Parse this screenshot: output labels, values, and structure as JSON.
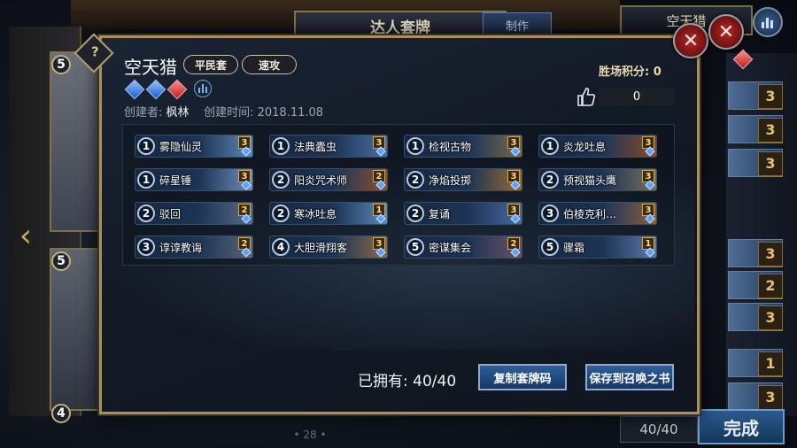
{
  "background": {
    "header_title": "达人套牌",
    "make_tab_label": "制作",
    "deck_name_tab": "空天猎",
    "left_costs": [
      "5",
      "5",
      "4"
    ],
    "right_counts": [
      "3",
      "3",
      "3",
      "3",
      "2",
      "3",
      "1",
      "3"
    ],
    "deck_count": "40/40",
    "done_label": "完成",
    "page_number": "• 28 •"
  },
  "dialog": {
    "deck_name": "空天猎",
    "tags": [
      "平民套",
      "速攻"
    ],
    "gems": [
      "blue",
      "blue",
      "red"
    ],
    "creator_label": "创建者:",
    "creator": "枫林",
    "created_label": "创建时间:",
    "created": "2018.11.08",
    "win_points_label": "胜场积分: 0",
    "likes": "0",
    "owned_label": "已拥有:",
    "owned_value": "40/40",
    "copy_button": "复制套牌码",
    "save_button": "保存到召唤之书",
    "cards": [
      {
        "cost": "1",
        "name": "雾隐仙灵",
        "qty": "3",
        "art": "#5c88b8"
      },
      {
        "cost": "1",
        "name": "法典蠹虫",
        "qty": "3",
        "art": "#4a6fa5"
      },
      {
        "cost": "1",
        "name": "检视古物",
        "qty": "3",
        "art": "#7a6a48"
      },
      {
        "cost": "1",
        "name": "炎龙吐息",
        "qty": "3",
        "art": "#8a4a2a"
      },
      {
        "cost": "1",
        "name": "碎星锤",
        "qty": "3",
        "art": "#6f8fb8"
      },
      {
        "cost": "2",
        "name": "阳炎咒术师",
        "qty": "2",
        "art": "#8a5030"
      },
      {
        "cost": "2",
        "name": "净焰投掷",
        "qty": "3",
        "art": "#9a6a30"
      },
      {
        "cost": "2",
        "name": "预视猫头鹰",
        "qty": "3",
        "art": "#7a7058"
      },
      {
        "cost": "2",
        "name": "驳回",
        "qty": "2",
        "art": "#5a6a88"
      },
      {
        "cost": "2",
        "name": "寒冰吐息",
        "qty": "1",
        "art": "#5a8ab8"
      },
      {
        "cost": "2",
        "name": "复诵",
        "qty": "3",
        "art": "#4a68a0"
      },
      {
        "cost": "3",
        "name": "伯棱克利神迹...",
        "qty": "3",
        "art": "#8a6040"
      },
      {
        "cost": "3",
        "name": "谆谆教诲",
        "qty": "2",
        "art": "#5a6478"
      },
      {
        "cost": "4",
        "name": "大胆滑翔客",
        "qty": "3",
        "art": "#8a6a48"
      },
      {
        "cost": "5",
        "name": "密谋集会",
        "qty": "2",
        "art": "#6a5068"
      },
      {
        "cost": "5",
        "name": "骤霜",
        "qty": "1",
        "art": "#5a7aa8"
      }
    ]
  }
}
